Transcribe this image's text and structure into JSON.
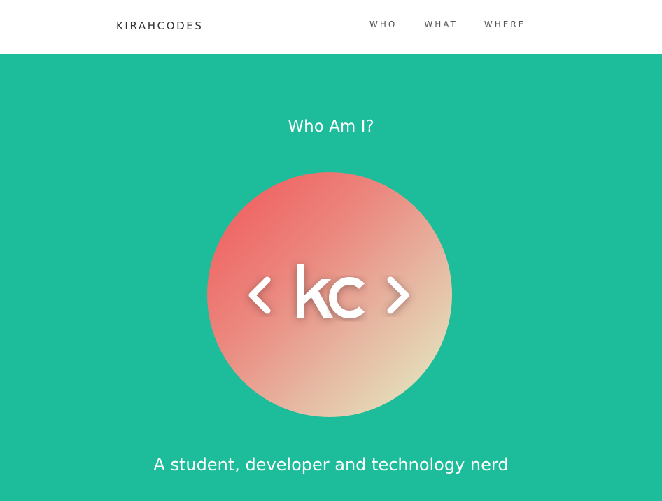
{
  "nav": {
    "brand": "KIRAHCODES",
    "links": [
      {
        "label": "WHO"
      },
      {
        "label": "WHAT"
      },
      {
        "label": "WHERE"
      }
    ]
  },
  "hero": {
    "title": "Who Am I?",
    "logo": {
      "text": "<kc>",
      "icon": "kc-code-logo"
    },
    "tagline": "A student, developer and technology nerd"
  },
  "colors": {
    "background": "#1dbc9a",
    "navbar": "#ffffff",
    "logo_gradient_start": "#f15458",
    "logo_gradient_end": "#e3f2c6",
    "text_light": "#ffffff"
  }
}
